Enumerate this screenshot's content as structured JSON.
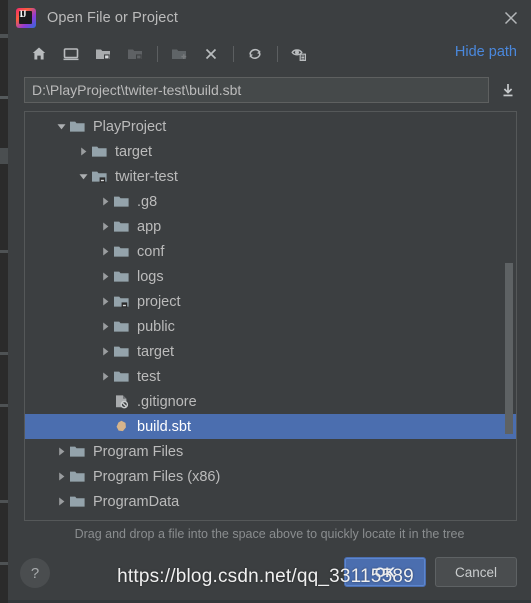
{
  "window": {
    "title": "Open File or Project",
    "app_icon": "intellij-idea-logo",
    "close_icon": "close-icon"
  },
  "toolbar": {
    "buttons": [
      {
        "name": "home-icon",
        "tooltip": "Home",
        "disabled": false
      },
      {
        "name": "desktop-icon",
        "tooltip": "Desktop",
        "disabled": false
      },
      {
        "name": "folder-up-icon",
        "tooltip": "Up",
        "disabled": false
      },
      {
        "name": "folder-icon",
        "tooltip": "Folder",
        "disabled": true
      },
      {
        "name": "new-folder-icon",
        "tooltip": "New Folder",
        "disabled": false
      },
      {
        "name": "delete-icon",
        "tooltip": "Delete",
        "disabled": false
      },
      {
        "name": "refresh-icon",
        "tooltip": "Refresh",
        "disabled": false
      },
      {
        "name": "show-hidden-icon",
        "tooltip": "Show Hidden Files",
        "disabled": false
      }
    ],
    "hide_path_label": "Hide path"
  },
  "path_field": {
    "value": "D:\\PlayProject\\twiter-test\\build.sbt",
    "placeholder": "",
    "dropdown_icon": "download-icon"
  },
  "tree": {
    "rows": [
      {
        "label": "PlayProject",
        "indent": 0,
        "twisty": "down",
        "icon": "folder",
        "selected": false
      },
      {
        "label": "target",
        "indent": 1,
        "twisty": "right",
        "icon": "folder",
        "selected": false
      },
      {
        "label": "twiter-test",
        "indent": 1,
        "twisty": "down",
        "icon": "folder-module",
        "selected": false
      },
      {
        "label": ".g8",
        "indent": 2,
        "twisty": "right",
        "icon": "folder",
        "selected": false
      },
      {
        "label": "app",
        "indent": 2,
        "twisty": "right",
        "icon": "folder",
        "selected": false
      },
      {
        "label": "conf",
        "indent": 2,
        "twisty": "right",
        "icon": "folder",
        "selected": false
      },
      {
        "label": "logs",
        "indent": 2,
        "twisty": "right",
        "icon": "folder",
        "selected": false
      },
      {
        "label": "project",
        "indent": 2,
        "twisty": "right",
        "icon": "folder-module",
        "selected": false
      },
      {
        "label": "public",
        "indent": 2,
        "twisty": "right",
        "icon": "folder",
        "selected": false
      },
      {
        "label": "target",
        "indent": 2,
        "twisty": "right",
        "icon": "folder",
        "selected": false
      },
      {
        "label": "test",
        "indent": 2,
        "twisty": "right",
        "icon": "folder",
        "selected": false
      },
      {
        "label": ".gitignore",
        "indent": 2,
        "twisty": "none",
        "icon": "ignored-file",
        "selected": false
      },
      {
        "label": "build.sbt",
        "indent": 2,
        "twisty": "none",
        "icon": "sbt-file",
        "selected": true
      },
      {
        "label": "Program Files",
        "indent": 0,
        "twisty": "right",
        "icon": "folder",
        "selected": false
      },
      {
        "label": "Program Files (x86)",
        "indent": 0,
        "twisty": "right",
        "icon": "folder",
        "selected": false
      },
      {
        "label": "ProgramData",
        "indent": 0,
        "twisty": "right",
        "icon": "folder",
        "selected": false
      }
    ],
    "scrollbar": {
      "thumb_top_pct": 37,
      "thumb_height_pct": 42
    }
  },
  "hint": {
    "text": "Drag and drop a file into the space above to quickly locate it in the tree"
  },
  "footer": {
    "help_label": "?",
    "ok_label": "OK",
    "cancel_label": "Cancel"
  },
  "watermark": {
    "text": "https://blog.csdn.net/qq_33115589"
  },
  "colors": {
    "background": "#3c3f41",
    "selection": "#4b6eaf",
    "link": "#4a88dd",
    "text": "#bbbbbb",
    "folder": "#94a3ab",
    "sbt_file": "#d6b48c"
  }
}
